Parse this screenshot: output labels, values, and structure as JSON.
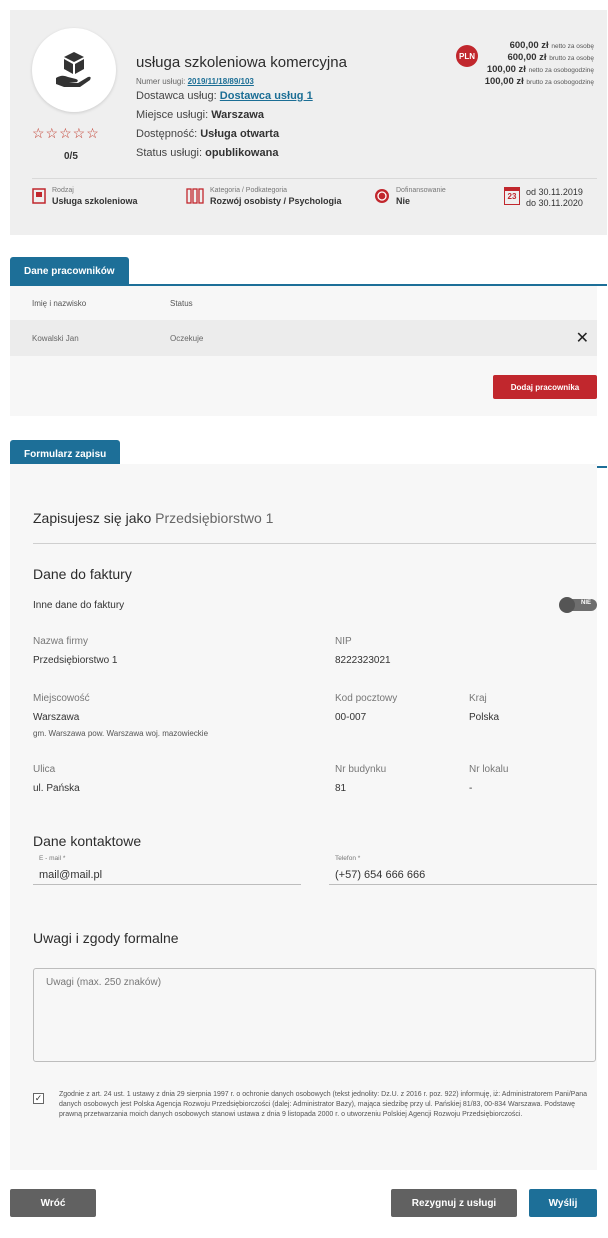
{
  "service": {
    "title": "usługa szkoleniowa komercyjna",
    "number_label": "Numer usługi",
    "number_value": "2019/11/18/89/103",
    "stars": "☆☆☆☆☆",
    "rating": "0/5",
    "provider_label": "Dostawca usług:",
    "provider_value": "Dostawca usług 1",
    "place_label": "Miejsce usługi:",
    "place_value": "Warszawa",
    "availability_label": "Dostępność:",
    "availability_value": "Usługa otwarta",
    "status_label": "Status usługi:",
    "status_value": "opublikowana",
    "currency_badge": "PLN",
    "prices": [
      {
        "amount": "600,00 zł",
        "note": "netto za osobę"
      },
      {
        "amount": "600,00 zł",
        "note": "brutto za osobę"
      },
      {
        "amount": "100,00 zł",
        "note": "netto za osobogodzinę"
      },
      {
        "amount": "100,00 zł",
        "note": "brutto za osobogodzinę"
      }
    ],
    "type_label": "Rodzaj",
    "type_value": "Usługa szkoleniowa",
    "category_label": "Kategoria / Podkategoria",
    "category_value": "Rozwój osobisty / Psychologia",
    "funding_label": "Dofinansowanie",
    "funding_value": "Nie",
    "calendar_day": "23",
    "date_from": "od 30.11.2019",
    "date_to": "do 30.11.2020"
  },
  "employees": {
    "tab_label": "Dane pracowników",
    "col_name": "Imię i nazwisko",
    "col_status": "Status",
    "rows": [
      {
        "name": "Kowalski Jan",
        "status": "Oczekuje"
      }
    ],
    "remove_glyph": "✕",
    "add_button": "Dodaj pracownika"
  },
  "form": {
    "tab_label": "Formularz zapisu",
    "signing_as": "Zapisujesz się jako",
    "signing_firm": "Przedsiębiorstwo 1",
    "invoice_heading": "Dane do faktury",
    "other_invoice_label": "Inne dane do faktury",
    "toggle_text": "NIE",
    "company_label": "Nazwa firmy",
    "company_value": "Przedsiębiorstwo 1",
    "nip_label": "NIP",
    "nip_value": "8222323021",
    "city_label": "Miejscowość",
    "city_value": "Warszawa",
    "city_sub": "gm. Warszawa pow. Warszawa woj. mazowieckie",
    "postal_label": "Kod pocztowy",
    "postal_value": "00-007",
    "country_label": "Kraj",
    "country_value": "Polska",
    "street_label": "Ulica",
    "street_value": "ul. Pańska",
    "building_label": "Nr budynku",
    "building_value": "81",
    "unit_label": "Nr lokalu",
    "unit_value": "-",
    "contact_heading": "Dane kontaktowe",
    "email_label": "E - mail *",
    "email_value": "mail@mail.pl",
    "phone_label": "Telefon *",
    "phone_value": "(+57) 654 666 666",
    "remarks_heading": "Uwagi i zgody formalne",
    "remarks_placeholder": "Uwagi (max. 250 znaków)",
    "consent_text": "Zgodnie z art. 24 ust. 1 ustawy z dnia 29 sierpnia 1997 r. o ochronie danych osobowych (tekst jednolity: Dz.U. z 2016 r. poz. 922) informuję, iż: Administratorem Pani/Pana danych osobowych jest Polska Agencja Rozwoju Przedsiębiorczości (dalej: Administrator Bazy), mająca siedzibę przy ul. Pańskiej 81/83, 00-834 Warszawa. Podstawę prawną przetwarzania moich danych osobowych stanowi ustawa z dnia 9 listopada 2000 r. o utworzeniu Polskiej Agencji Rozwoju Przedsiębiorczości.",
    "check_glyph": "✓"
  },
  "footer": {
    "back": "Wróć",
    "resign": "Rezygnuj z usługi",
    "send": "Wyślij"
  }
}
